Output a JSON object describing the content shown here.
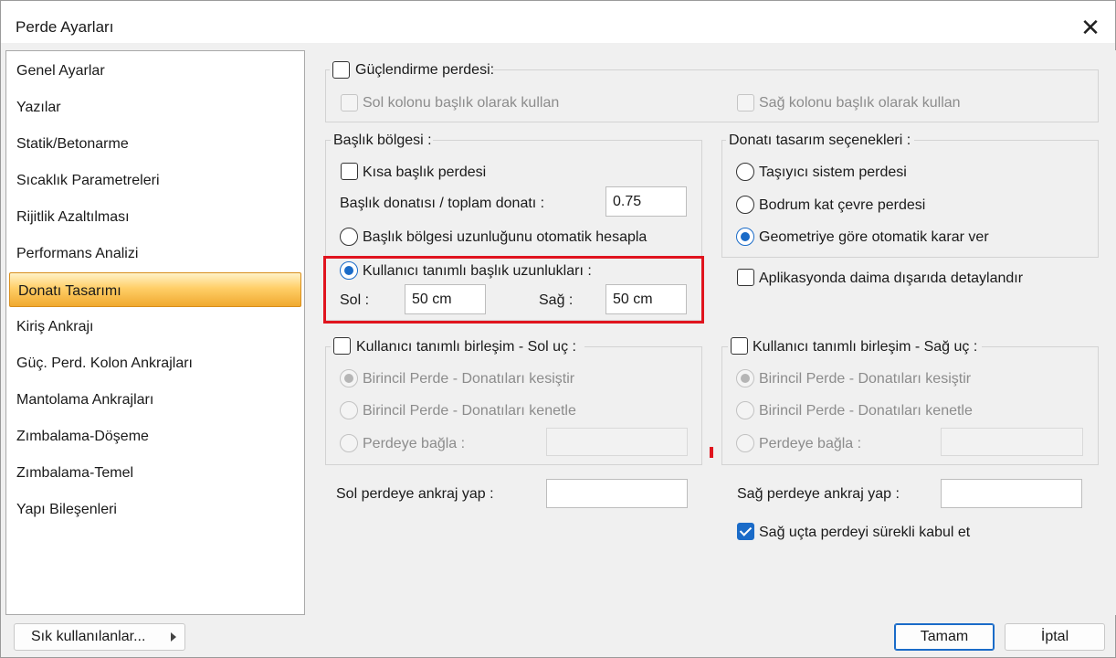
{
  "window": {
    "title": "Perde Ayarları",
    "close_icon": "close-icon"
  },
  "nav": {
    "items": [
      {
        "label": "Genel Ayarlar"
      },
      {
        "label": "Yazılar"
      },
      {
        "label": "Statik/Betonarme"
      },
      {
        "label": "Sıcaklık Parametreleri"
      },
      {
        "label": "Rijitlik Azaltılması"
      },
      {
        "label": "Performans Analizi"
      },
      {
        "label": "Donatı Tasarımı",
        "selected": true
      },
      {
        "label": "Kiriş Ankrajı"
      },
      {
        "label": "Güç. Perd. Kolon Ankrajları"
      },
      {
        "label": "Mantolama Ankrajları"
      },
      {
        "label": "Zımbalama-Döşeme"
      },
      {
        "label": "Zımbalama-Temel"
      },
      {
        "label": "Yapı Bileşenleri"
      }
    ]
  },
  "strengthening": {
    "label": "Güçlendirme perdesi:",
    "checked": false,
    "left_column_label": "Sol kolonu başlık olarak kullan",
    "right_column_label": "Sağ kolonu başlık olarak kullan"
  },
  "header_region": {
    "title": "Başlık bölgesi :",
    "short_header_label": "Kısa başlık perdesi",
    "ratio_label": "Başlık donatısı / toplam donatı :",
    "ratio_value": "0.75",
    "auto_length_label": "Başlık bölgesi uzunluğunu otomatik hesapla",
    "user_length_label": "Kullanıcı tanımlı başlık uzunlukları :",
    "left_label": "Sol :",
    "left_value": "50 cm",
    "right_label": "Sağ :",
    "right_value": "50 cm"
  },
  "design_options": {
    "title": "Donatı tasarım seçenekleri :",
    "options": [
      {
        "label": "Taşıyıcı sistem perdesi",
        "selected": false
      },
      {
        "label": "Bodrum kat çevre perdesi",
        "selected": false
      },
      {
        "label": "Geometriye göre otomatik karar ver",
        "selected": true
      }
    ],
    "always_outside_label": "Aplikasyonda daima dışarıda detaylandır"
  },
  "left_joint": {
    "label": "Kullanıcı tanımlı birleşim - Sol uç :",
    "options": [
      {
        "label": "Birincil Perde - Donatıları kesiştir",
        "selected": true
      },
      {
        "label": "Birincil Perde - Donatıları kenetle",
        "selected": false
      },
      {
        "label": "Perdeye bağla :",
        "selected": false
      }
    ]
  },
  "right_joint": {
    "label": "Kullanıcı tanımlı birleşim - Sağ uç :",
    "options": [
      {
        "label": "Birincil Perde - Donatıları kesiştir",
        "selected": true
      },
      {
        "label": "Birincil Perde - Donatıları kenetle",
        "selected": false
      },
      {
        "label": "Perdeye bağla :",
        "selected": false
      }
    ]
  },
  "anchors": {
    "left_label": "Sol perdeye ankraj yap :",
    "right_label": "Sağ perdeye ankraj yap :",
    "continuous_label": "Sağ uçta perdeyi sürekli kabul et",
    "continuous_checked": true
  },
  "footer": {
    "favorites_label": "Sık kullanılanlar...",
    "ok_label": "Tamam",
    "cancel_label": "İptal"
  },
  "colors": {
    "accent": "#1a6bc8",
    "highlight": "#e0141e",
    "selection": "#ffcf68"
  }
}
